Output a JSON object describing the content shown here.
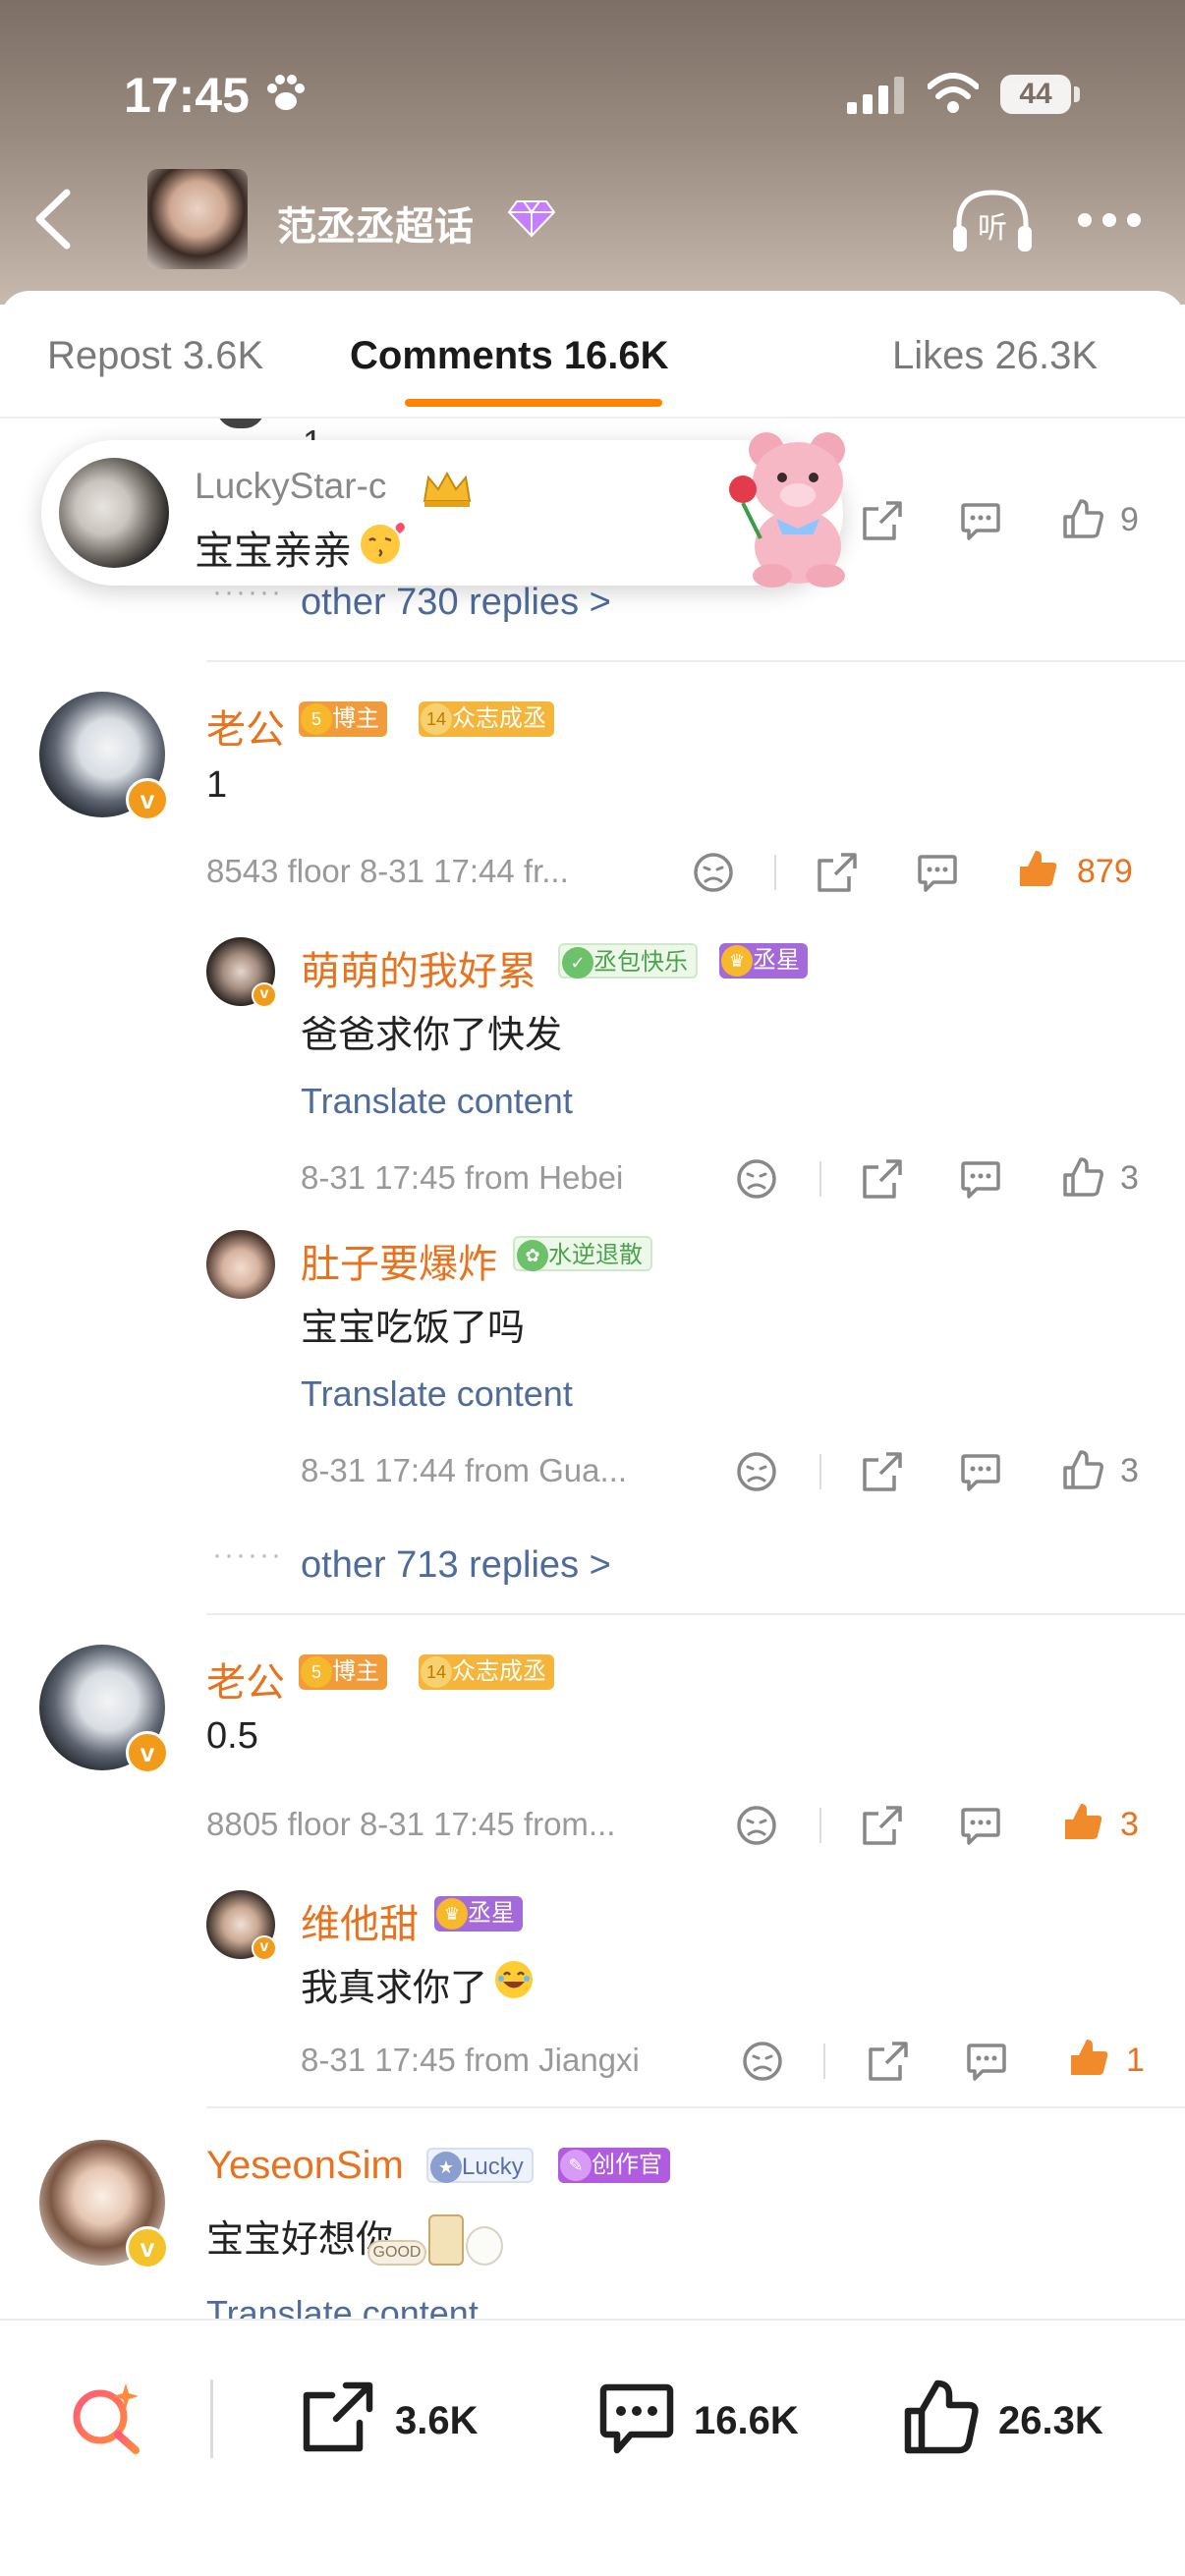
{
  "status": {
    "time": "17:45",
    "battery": "44"
  },
  "topic": {
    "title": "范丞丞超话",
    "listen_label": "听"
  },
  "tabs": [
    {
      "label": "Repost 3.6K"
    },
    {
      "label": "Comments 16.6K"
    },
    {
      "label": "Likes 26.3K"
    }
  ],
  "partial_comment": {
    "text": "1",
    "like_count": "9"
  },
  "replies_more_1": "other 730 replies >",
  "toast": {
    "name": "LuckyStar-c",
    "text": "宝宝亲亲"
  },
  "comments": [
    {
      "username": "老公",
      "badges": [
        "博主",
        "众志成丞"
      ],
      "badge_levels": [
        "5",
        "14"
      ],
      "text": "1",
      "meta": "8543 floor 8-31 17:44 fr...",
      "likes": "879",
      "replies": [
        {
          "username": "萌萌的我好累",
          "badges": [
            "丞包快乐",
            "丞星"
          ],
          "text": "爸爸求你了快发",
          "translate": "Translate content",
          "meta": "8-31 17:45 from Hebei",
          "likes": "3"
        },
        {
          "username": "肚子要爆炸",
          "badges": [
            "水逆退散"
          ],
          "text": "宝宝吃饭了吗",
          "translate": "Translate content",
          "meta": "8-31 17:44 from Gua...",
          "likes": "3"
        }
      ],
      "more": "other 713 replies >"
    },
    {
      "username": "老公",
      "badges": [
        "博主",
        "众志成丞"
      ],
      "badge_levels": [
        "5",
        "14"
      ],
      "text": "0.5",
      "meta": "8805 floor 8-31 17:45 from...",
      "likes": "3",
      "replies": [
        {
          "username": "维他甜",
          "badges": [
            "丞星"
          ],
          "text": "我真求你了",
          "meta": "8-31 17:45 from Jiangxi",
          "likes": "1"
        }
      ]
    },
    {
      "username": "YeseonSim",
      "badges": [
        "Lucky",
        "创作官"
      ],
      "text": "宝宝好想你",
      "sticker": "GOOD",
      "translate": "Translate content"
    }
  ],
  "footer": {
    "repost": "3.6K",
    "comments": "16.6K",
    "likes": "26.3K"
  },
  "colors": {
    "accent": "#ff8200",
    "username": "#e8731f",
    "link": "#4d6b9b"
  }
}
